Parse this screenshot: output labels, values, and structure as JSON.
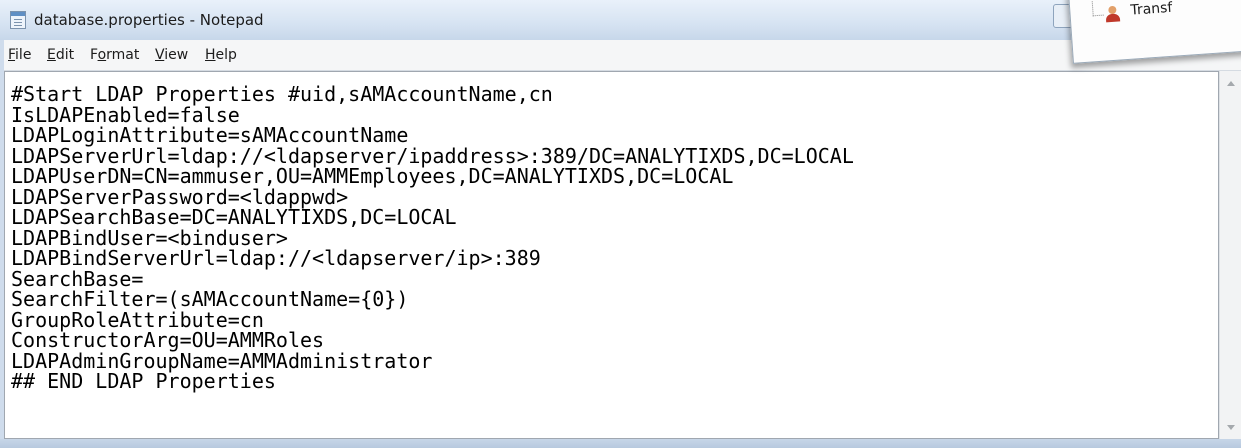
{
  "window": {
    "title": "database.properties - Notepad"
  },
  "popup": {
    "label": "Transf"
  },
  "menu": {
    "items": [
      {
        "label": "File",
        "underline": "F",
        "rest": "ile"
      },
      {
        "label": "Edit",
        "underline": "E",
        "rest": "dit"
      },
      {
        "label": "Format",
        "pre": "F",
        "underline": "o",
        "rest": "rmat"
      },
      {
        "label": "View",
        "underline": "V",
        "rest": "iew"
      },
      {
        "label": "Help",
        "underline": "H",
        "rest": "elp"
      }
    ]
  },
  "editor": {
    "lines": [
      "#Start LDAP Properties #uid,sAMAccountName,cn",
      "IsLDAPEnabled=false",
      "LDAPLoginAttribute=sAMAccountName",
      "LDAPServerUrl=ldap://<ldapserver/ipaddress>:389/DC=ANALYTIXDS,DC=LOCAL",
      "LDAPUserDN=CN=ammuser,OU=AMMEmployees,DC=ANALYTIXDS,DC=LOCAL",
      "LDAPServerPassword=<ldappwd>",
      "LDAPSearchBase=DC=ANALYTIXDS,DC=LOCAL",
      "LDAPBindUser=<binduser>",
      "LDAPBindServerUrl=ldap://<ldapserver/ip>:389",
      "SearchBase=",
      "SearchFilter=(sAMAccountName={0})",
      "GroupRoleAttribute=cn",
      "ConstructorArg=OU=AMMRoles",
      "LDAPAdminGroupName=AMMAdministrator",
      "## END LDAP Properties"
    ]
  },
  "icons": {
    "app": "notepad-icon",
    "popup": "user-icon",
    "scroll_up": "scroll-up-arrow-icon",
    "scroll_down": "scroll-down-arrow-icon"
  }
}
